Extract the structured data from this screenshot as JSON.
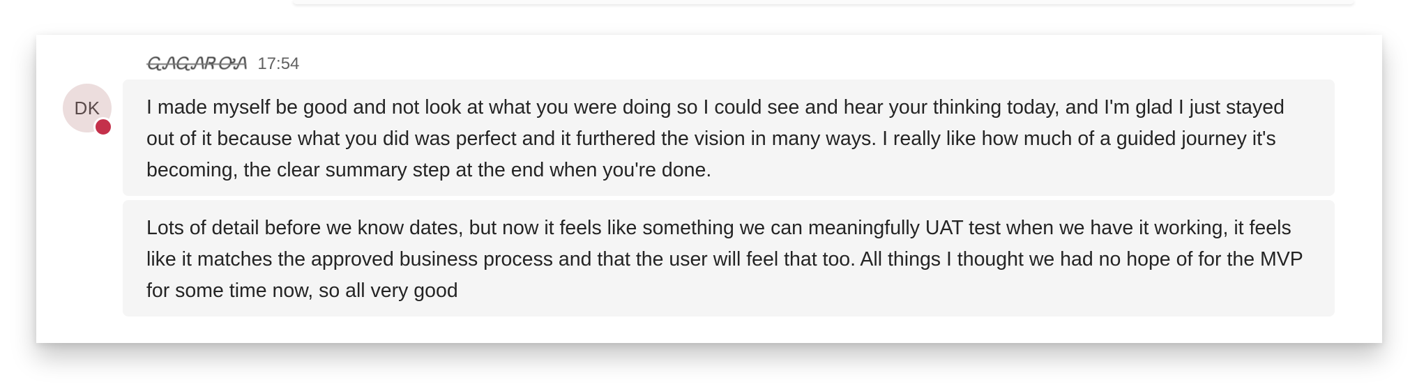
{
  "message": {
    "avatar_initials": "DK",
    "sender_name": "ᏩᏁᏩᏁᏒ ᎤᏁ",
    "timestamp": "17:54",
    "colors": {
      "avatar_bg": "#ecdddd",
      "presence_busy": "#c4314b",
      "bubble_bg": "#f5f5f5"
    },
    "bubbles": [
      {
        "text": "I made myself be good and not look at what you were doing so I could see and hear your thinking today, and I'm glad I just stayed out of it because what you did was perfect and it furthered the vision in many ways. I really like how much of a guided journey it's becoming, the clear summary step at the end when you're done."
      },
      {
        "text": "Lots of detail before we know dates, but now it feels like something we can meaningfully UAT test when we have it working, it feels like it matches the approved business process and that the user will feel that too. All things I thought we had no hope of for the MVP for some time now, so all very good"
      }
    ]
  }
}
